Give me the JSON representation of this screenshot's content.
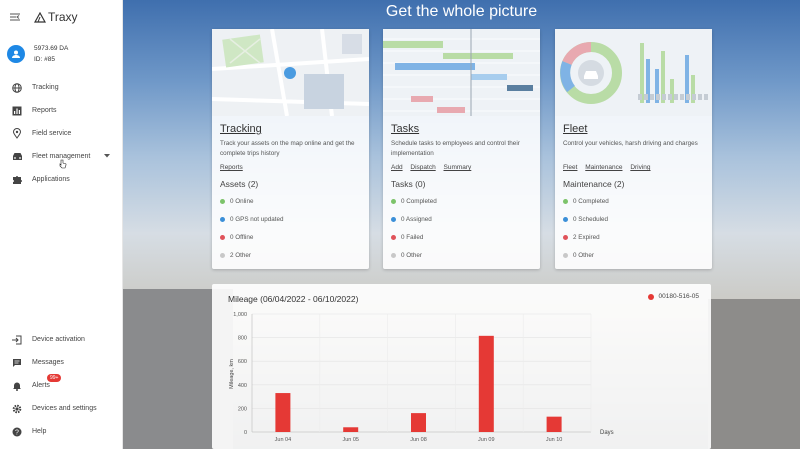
{
  "brand": {
    "name": "Traxy"
  },
  "account": {
    "balance": "5973.69 DA",
    "id": "ID: #85"
  },
  "nav": [
    {
      "label": "Tracking",
      "icon": "globe-icon"
    },
    {
      "label": "Reports",
      "icon": "bar-chart-icon"
    },
    {
      "label": "Field service",
      "icon": "location-pin-icon"
    },
    {
      "label": "Fleet management",
      "icon": "car-icon"
    },
    {
      "label": "Applications",
      "icon": "puzzle-icon"
    }
  ],
  "bottom_nav": [
    {
      "label": "Device activation",
      "icon": "login-icon"
    },
    {
      "label": "Messages",
      "icon": "message-icon"
    },
    {
      "label": "Alerts",
      "icon": "bell-icon",
      "badge": "99+"
    },
    {
      "label": "Devices and settings",
      "icon": "gear-icon"
    },
    {
      "label": "Help",
      "icon": "help-icon"
    }
  ],
  "hero": {
    "heading": "Get the whole picture"
  },
  "cards": {
    "tracking": {
      "title": "Tracking",
      "desc": "Track your assets on the map online and get the complete trips history",
      "links": [
        "Reports"
      ],
      "section": "Assets (2)",
      "stats": [
        {
          "label": "0 Online",
          "color": "#7cc36a"
        },
        {
          "label": "0 GPS not updated",
          "color": "#3b8fd8"
        },
        {
          "label": "0 Offline",
          "color": "#e0535a"
        },
        {
          "label": "2 Other",
          "color": "#c8c8c8"
        }
      ]
    },
    "tasks": {
      "title": "Tasks",
      "desc": "Schedule tasks to employees and control their implementation",
      "links": [
        "Add",
        "Dispatch",
        "Summary"
      ],
      "section": "Tasks (0)",
      "stats": [
        {
          "label": "0 Completed",
          "color": "#7cc36a"
        },
        {
          "label": "0 Assigned",
          "color": "#3b8fd8"
        },
        {
          "label": "0 Failed",
          "color": "#e0535a"
        },
        {
          "label": "0 Other",
          "color": "#c8c8c8"
        }
      ]
    },
    "fleet": {
      "title": "Fleet",
      "desc": "Control your vehicles, harsh driving and charges",
      "links": [
        "Fleet",
        "Maintenance",
        "Driving"
      ],
      "section": "Maintenance (2)",
      "stats": [
        {
          "label": "0 Completed",
          "color": "#7cc36a"
        },
        {
          "label": "0 Scheduled",
          "color": "#3b8fd8"
        },
        {
          "label": "2 Expired",
          "color": "#e0535a"
        },
        {
          "label": "0 Other",
          "color": "#c8c8c8"
        }
      ]
    }
  },
  "chart_data": {
    "type": "bar",
    "title": "Mileage (06/04/2022 - 06/10/2022)",
    "ylabel": "Mileage, km",
    "xlabel": "Days",
    "categories": [
      "Jun 04",
      "Jun 05",
      "Jun 08",
      "Jun 09",
      "Jun 10"
    ],
    "series": [
      {
        "name": "00180-516-05",
        "color": "#e53935",
        "values": [
          330,
          40,
          160,
          815,
          130
        ]
      }
    ],
    "yticks": [
      0,
      200,
      400,
      600,
      800,
      1000
    ],
    "ylim": [
      0,
      1000
    ],
    "grid": true,
    "legend": "top-right"
  }
}
